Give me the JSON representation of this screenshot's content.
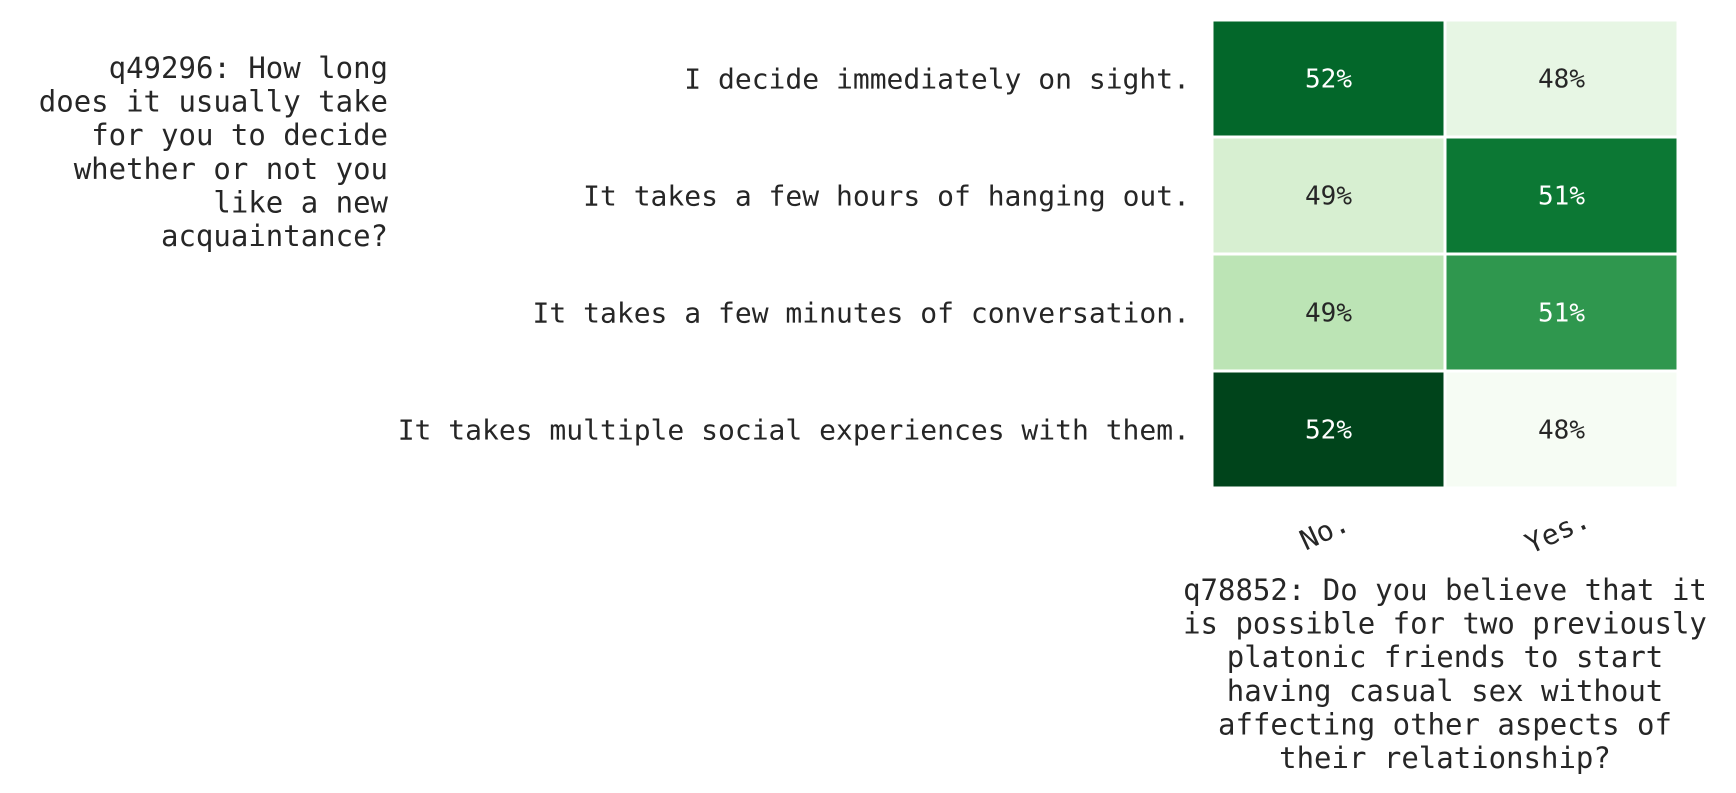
{
  "chart_data": {
    "type": "heatmap",
    "title": "",
    "ylabel": "q49296: How long does it usually take for you to decide whether or not you like a new acquaintance?",
    "ylabel_lines": [
      "q49296: How long",
      "does it usually take",
      "for you to decide",
      "whether or not you",
      "like a new",
      "acquaintance?"
    ],
    "xlabel": "q78852: Do you believe that it is possible for two previously platonic friends to start having casual sex without affecting other aspects of their relationship?",
    "xlabel_lines": [
      "q78852: Do you believe that it",
      "is possible for two previously",
      "platonic friends to start",
      "having casual sex without",
      "affecting other aspects of",
      "their relationship?"
    ],
    "columns": [
      "No.",
      "Yes."
    ],
    "rows": [
      "I decide immediately on sight.",
      "It takes a few hours of hanging out.",
      "It takes a few minutes of conversation.",
      "It takes multiple social experiences with them."
    ],
    "values": [
      [
        52,
        48
      ],
      [
        49,
        51
      ],
      [
        49,
        51
      ],
      [
        52,
        48
      ]
    ],
    "cell_labels": [
      [
        "52%",
        "48%"
      ],
      [
        "49%",
        "51%"
      ],
      [
        "49%",
        "51%"
      ],
      [
        "52%",
        "48%"
      ]
    ],
    "colors": [
      [
        "#03672a",
        "#e7f6e4"
      ],
      [
        "#d7efd1",
        "#0c7834"
      ],
      [
        "#bce4b5",
        "#2f974e"
      ],
      [
        "#00441b",
        "#f6fcf4"
      ]
    ],
    "label_colors": [
      [
        "#ffffff",
        "#262626"
      ],
      [
        "#262626",
        "#ffffff"
      ],
      [
        "#262626",
        "#ffffff"
      ],
      [
        "#ffffff",
        "#262626"
      ]
    ],
    "colormap": "Greens",
    "grid": false,
    "legend": "none"
  }
}
